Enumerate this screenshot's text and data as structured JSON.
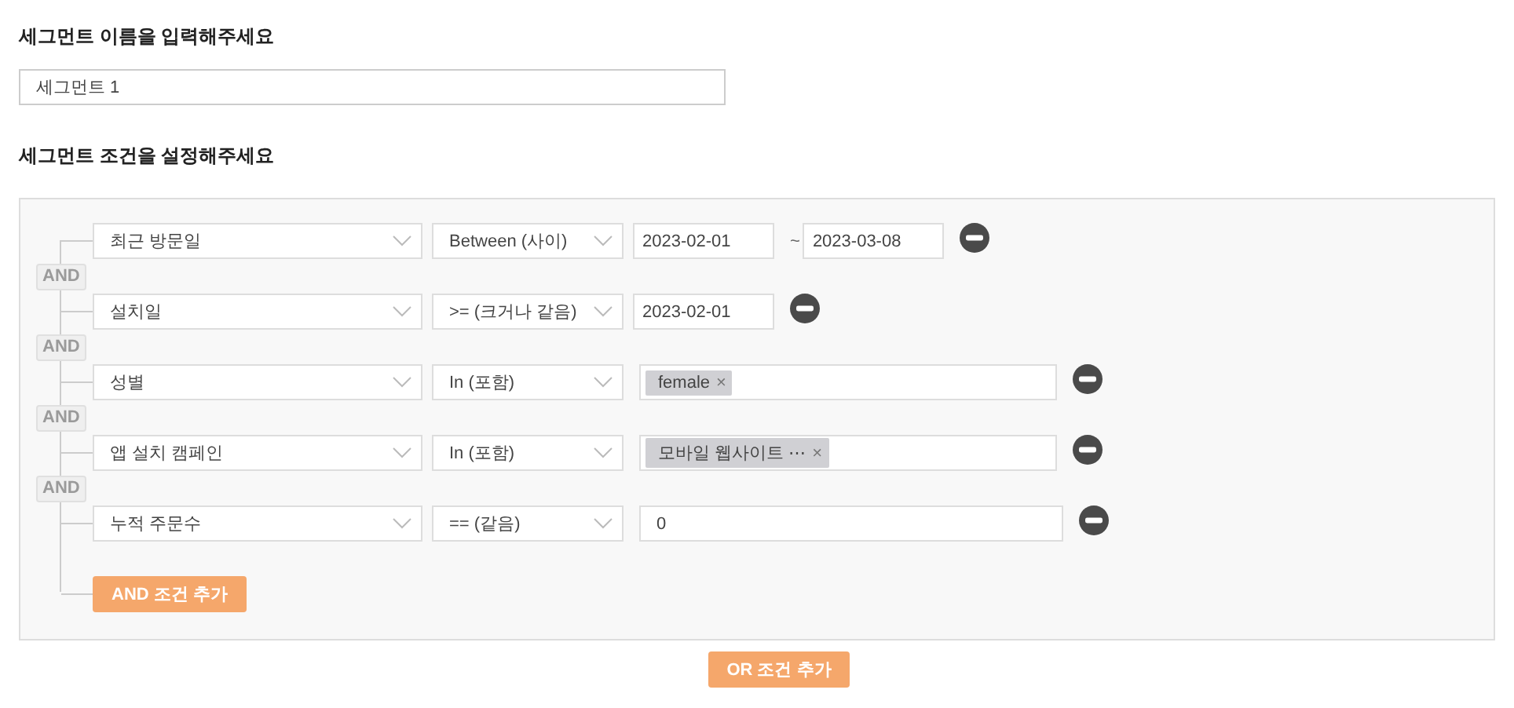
{
  "segment_name": {
    "label": "세그먼트 이름을 입력해주세요",
    "value": "세그먼트 1"
  },
  "conditions": {
    "label": "세그먼트 조건을 설정해주세요",
    "rows": [
      {
        "field": "최근 방문일",
        "operator": "Between (사이)",
        "kind": "date_range",
        "values": [
          "2023-02-01",
          "2023-03-08"
        ],
        "separator": "~"
      },
      {
        "joiner": "AND",
        "field": "설치일",
        "operator": ">= (크거나 같음)",
        "kind": "date",
        "values": [
          "2023-02-01"
        ]
      },
      {
        "joiner": "AND",
        "field": "성별",
        "operator": "In (포함)",
        "kind": "tags",
        "tags": [
          {
            "text": "female",
            "remove": "×"
          }
        ]
      },
      {
        "joiner": "AND",
        "field": "앱 설치 캠페인",
        "operator": "In (포함)",
        "kind": "tags",
        "tags": [
          {
            "text": "모바일 웹사이트 ⋯",
            "remove": "×"
          }
        ]
      },
      {
        "joiner": "AND",
        "field": "누적 주문수",
        "operator": "== (같음)",
        "kind": "text",
        "values": [
          "0"
        ]
      }
    ],
    "add_and_button": "AND 조건 추가"
  },
  "add_or_button": "OR 조건 추가"
}
